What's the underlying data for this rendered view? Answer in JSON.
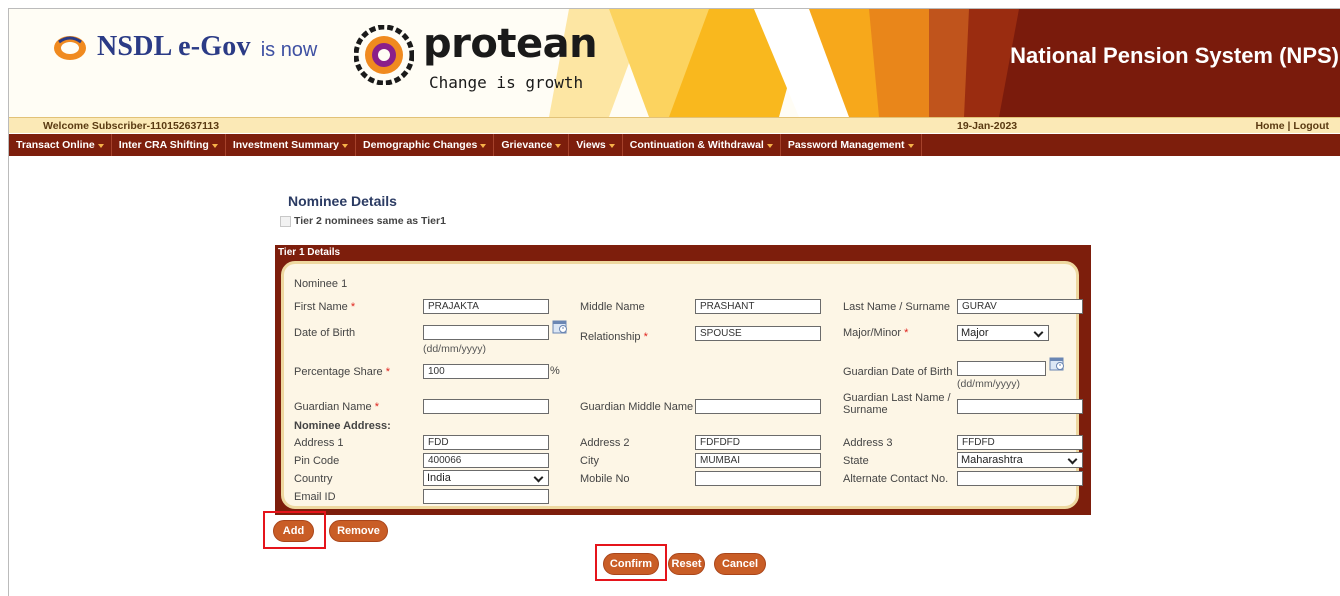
{
  "header": {
    "nsdl_brand": "NSDL e-Gov",
    "is_now": "is now",
    "protean_brand": "protean",
    "protean_tagline": "Change is growth",
    "system_title": "National Pension System (NPS)"
  },
  "welcome_bar": {
    "welcome": "Welcome Subscriber-110152637113",
    "date": "19-Jan-2023",
    "home": "Home",
    "separator": "|",
    "logout": "Logout"
  },
  "nav": {
    "items": [
      {
        "label": "Transact Online"
      },
      {
        "label": "Inter CRA Shifting"
      },
      {
        "label": "Investment Summary"
      },
      {
        "label": "Demographic Changes"
      },
      {
        "label": "Grievance"
      },
      {
        "label": "Views"
      },
      {
        "label": "Continuation & Withdrawal"
      },
      {
        "label": "Password Management"
      }
    ]
  },
  "nominee": {
    "section_title": "Nominee Details",
    "tier2_same_label": "Tier 2 nominees same as Tier1",
    "tier1_header": "Tier 1 Details",
    "nominee_heading": "Nominee  1",
    "labels": {
      "first_name": "First Name",
      "middle_name": "Middle Name",
      "last_name": "Last Name / Surname",
      "dob": "Date of Birth",
      "relationship": "Relationship",
      "major_minor": "Major/Minor",
      "percentage_share": "Percentage Share",
      "guardian_dob": "Guardian Date of Birth",
      "guardian_name": "Guardian Name",
      "guardian_middle": "Guardian Middle Name",
      "guardian_last": "Guardian Last Name / Surname",
      "address_heading": "Nominee Address:",
      "address1": "Address 1",
      "address2": "Address 2",
      "address3": "Address 3",
      "pin": "Pin Code",
      "city": "City",
      "state": "State",
      "country": "Country",
      "mobile": "Mobile No",
      "alt_contact": "Alternate Contact No.",
      "email": "Email ID"
    },
    "required_marker": "*",
    "date_hint": "(dd/mm/yyyy)",
    "percent_sign": "%",
    "values": {
      "first_name": "PRAJAKTA",
      "middle_name": "PRASHANT",
      "last_name": "GURAV",
      "dob": "",
      "relationship": "SPOUSE",
      "major_minor": "Major",
      "percentage_share": "100",
      "guardian_dob": "",
      "guardian_name": "",
      "guardian_middle": "",
      "guardian_last": "",
      "address1": "FDD",
      "address2": "FDFDFD",
      "address3": "FFDFD",
      "pin": "400066",
      "city": "MUMBAI",
      "state": "Maharashtra",
      "country": "India",
      "mobile": "",
      "alt_contact": "",
      "email": ""
    }
  },
  "buttons": {
    "add": "Add",
    "remove": "Remove",
    "confirm": "Confirm",
    "reset": "Reset",
    "cancel": "Cancel"
  },
  "colors": {
    "brand_maroon": "#7d1e0c",
    "button_orange": "#c95d26",
    "welcome_bg": "#fbe9b6",
    "highlight_red": "#e5141b"
  }
}
